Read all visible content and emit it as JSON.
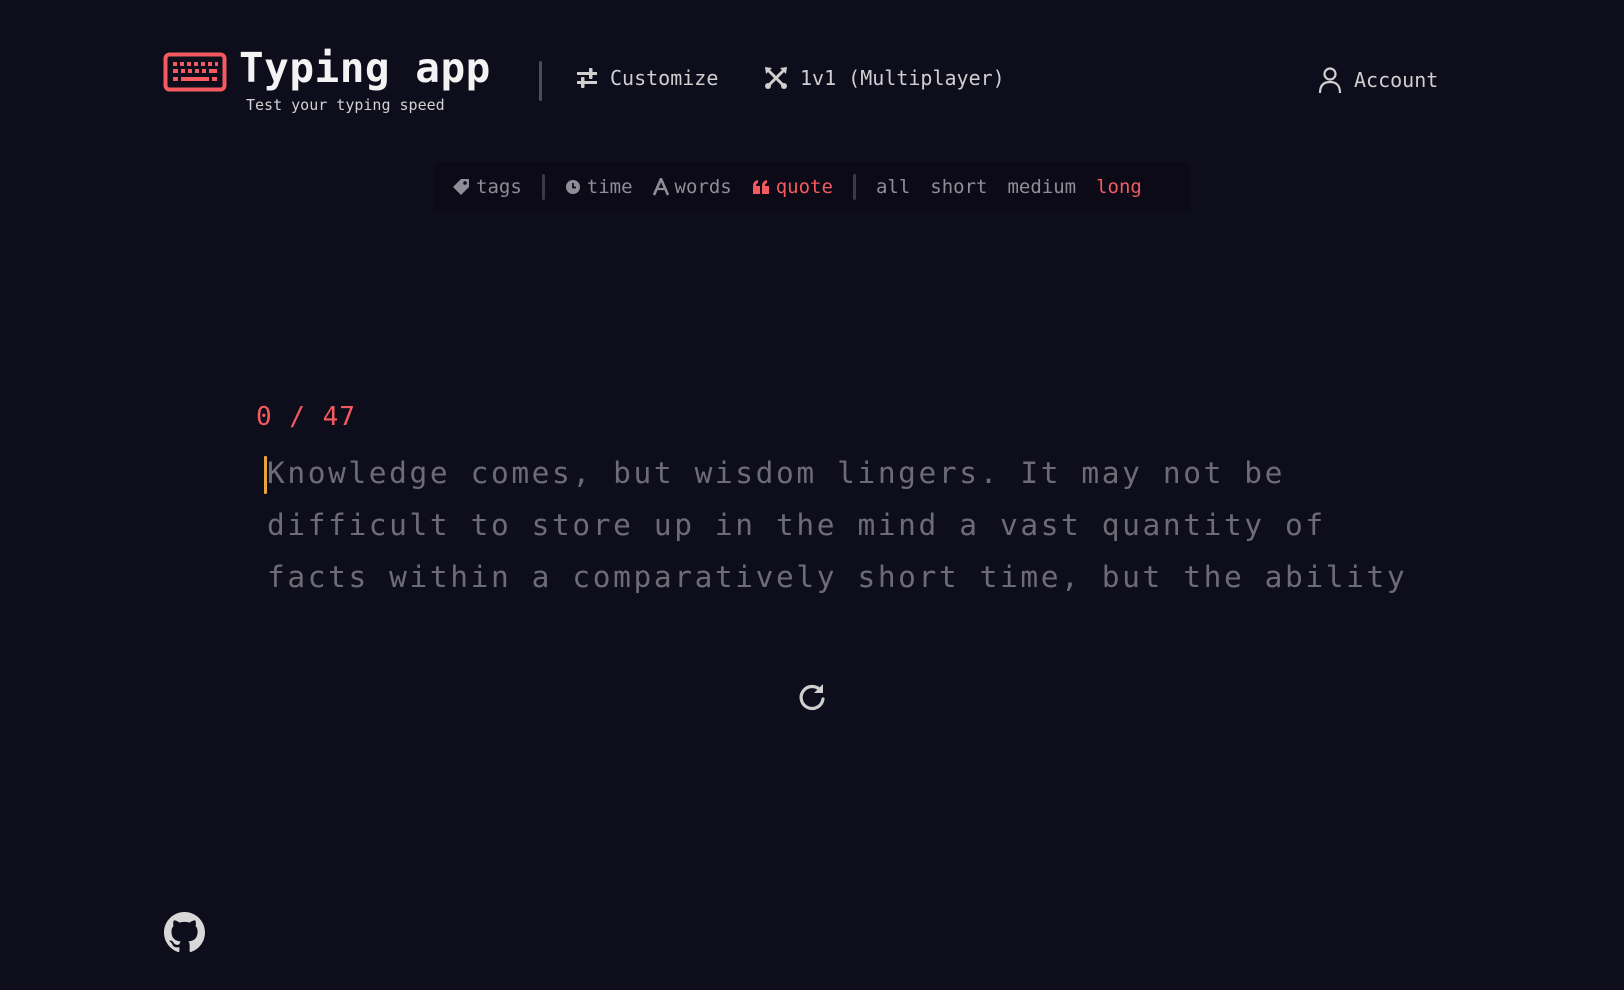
{
  "header": {
    "title": "Typing app",
    "subtitle": "Test your typing speed",
    "nav": {
      "customize": "Customize",
      "multiplayer": "1v1 (Multiplayer)",
      "account": "Account"
    }
  },
  "modebar": {
    "tags": "tags",
    "modes": {
      "time": "time",
      "words": "words",
      "quote": "quote"
    },
    "active_mode": "quote",
    "lengths": {
      "all": "all",
      "short": "short",
      "medium": "medium",
      "long": "long"
    },
    "active_length": "long"
  },
  "test": {
    "counter": "0 / 47",
    "lines": [
      "Knowledge comes, but wisdom lingers. It may not be",
      "difficult to store up in the mind a vast quantity of",
      "facts within a comparatively short time, but the ability"
    ]
  },
  "icons": {
    "logo": "keyboard-icon",
    "customize": "sliders-icon",
    "multiplayer": "crossed-swords-icon",
    "account": "user-icon",
    "tags": "tag-icon",
    "time": "clock-icon",
    "words": "letter-a-icon",
    "quote": "quote-icon",
    "restart": "refresh-icon",
    "footer": "github-icon"
  },
  "colors": {
    "background": "#0e0d1b",
    "accent": "#f45a5f",
    "caret": "#e8a33c",
    "untyped": "#6d6c75",
    "muted": "#8e8e98"
  }
}
